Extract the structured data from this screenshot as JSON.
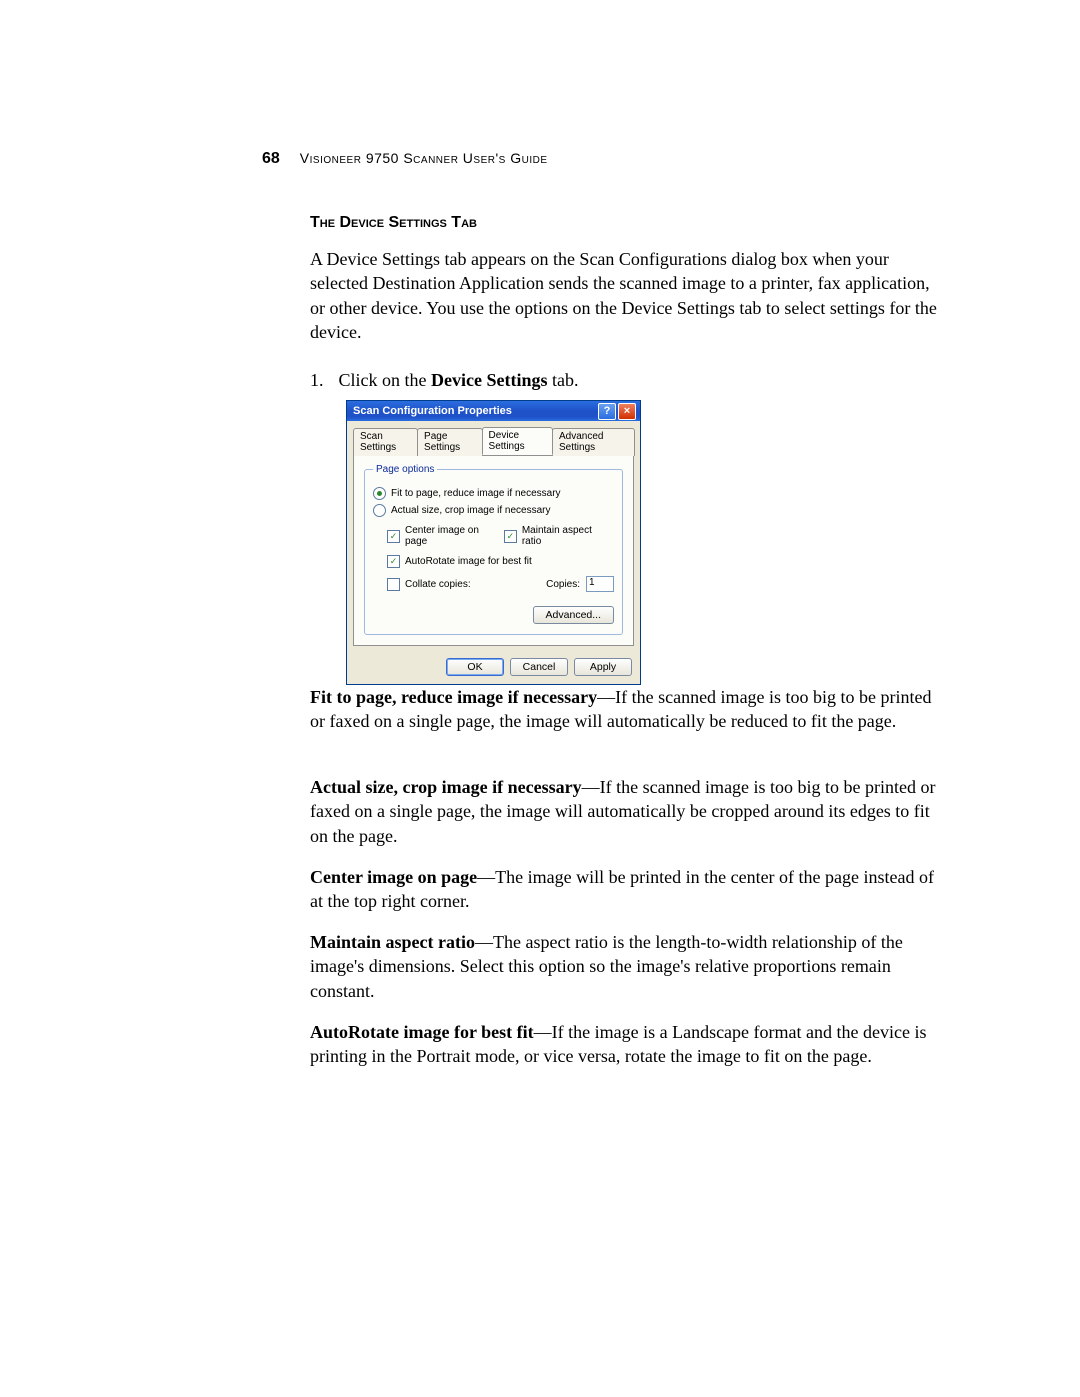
{
  "header": {
    "page_number": "68",
    "guide_title": "Visioneer 9750 Scanner User's Guide"
  },
  "section": {
    "heading": "The Device Settings Tab"
  },
  "intro_text": "A Device Settings tab appears on the Scan Configurations dialog box when your selected Destination Application sends the scanned image to a printer, fax application, or other device. You use the options on the Device Settings tab to select settings for the device.",
  "step": {
    "number": "1.",
    "prefix": "Click on the ",
    "bold": "Device Settings",
    "suffix": " tab."
  },
  "dialog": {
    "title": "Scan Configuration Properties",
    "help": "?",
    "close": "×",
    "tabs": {
      "scan": "Scan Settings",
      "page": "Page Settings",
      "device": "Device Settings",
      "advanced": "Advanced Settings"
    },
    "group_legend": "Page options",
    "radio_fit": "Fit to page, reduce image if necessary",
    "radio_actual": "Actual size, crop image if necessary",
    "check_center": "Center image on page",
    "check_maintain": "Maintain aspect ratio",
    "check_autorotate": "AutoRotate image for best fit",
    "check_collate": "Collate copies:",
    "copies_label": "Copies:",
    "copies_value": "1",
    "btn_advanced": "Advanced...",
    "btn_ok": "OK",
    "btn_cancel": "Cancel",
    "btn_apply": "Apply"
  },
  "descriptions": {
    "d1_bold": "Fit to page, reduce image if necessary",
    "d1_text": "—If the scanned image is too big to be printed or faxed on a single page, the image will automatically be reduced to fit the page.",
    "d2_bold": "Actual size, crop image if necessary",
    "d2_text": "—If the scanned image is too big to be printed or faxed on a single page, the image will automatically be cropped around its edges to fit on the page.",
    "d3_bold": "Center image on page",
    "d3_text": "—The image will be printed in the center of the page instead of at the top right corner.",
    "d4_bold": "Maintain aspect ratio",
    "d4_text": "—The aspect ratio is the length-to-width relationship of the image's dimensions. Select this option so the image's relative proportions remain constant.",
    "d5_bold": "AutoRotate image for best fit",
    "d5_text": "—If the image is a Landscape format and the device is printing in the Portrait mode, or vice versa, rotate the image to fit on the page."
  }
}
